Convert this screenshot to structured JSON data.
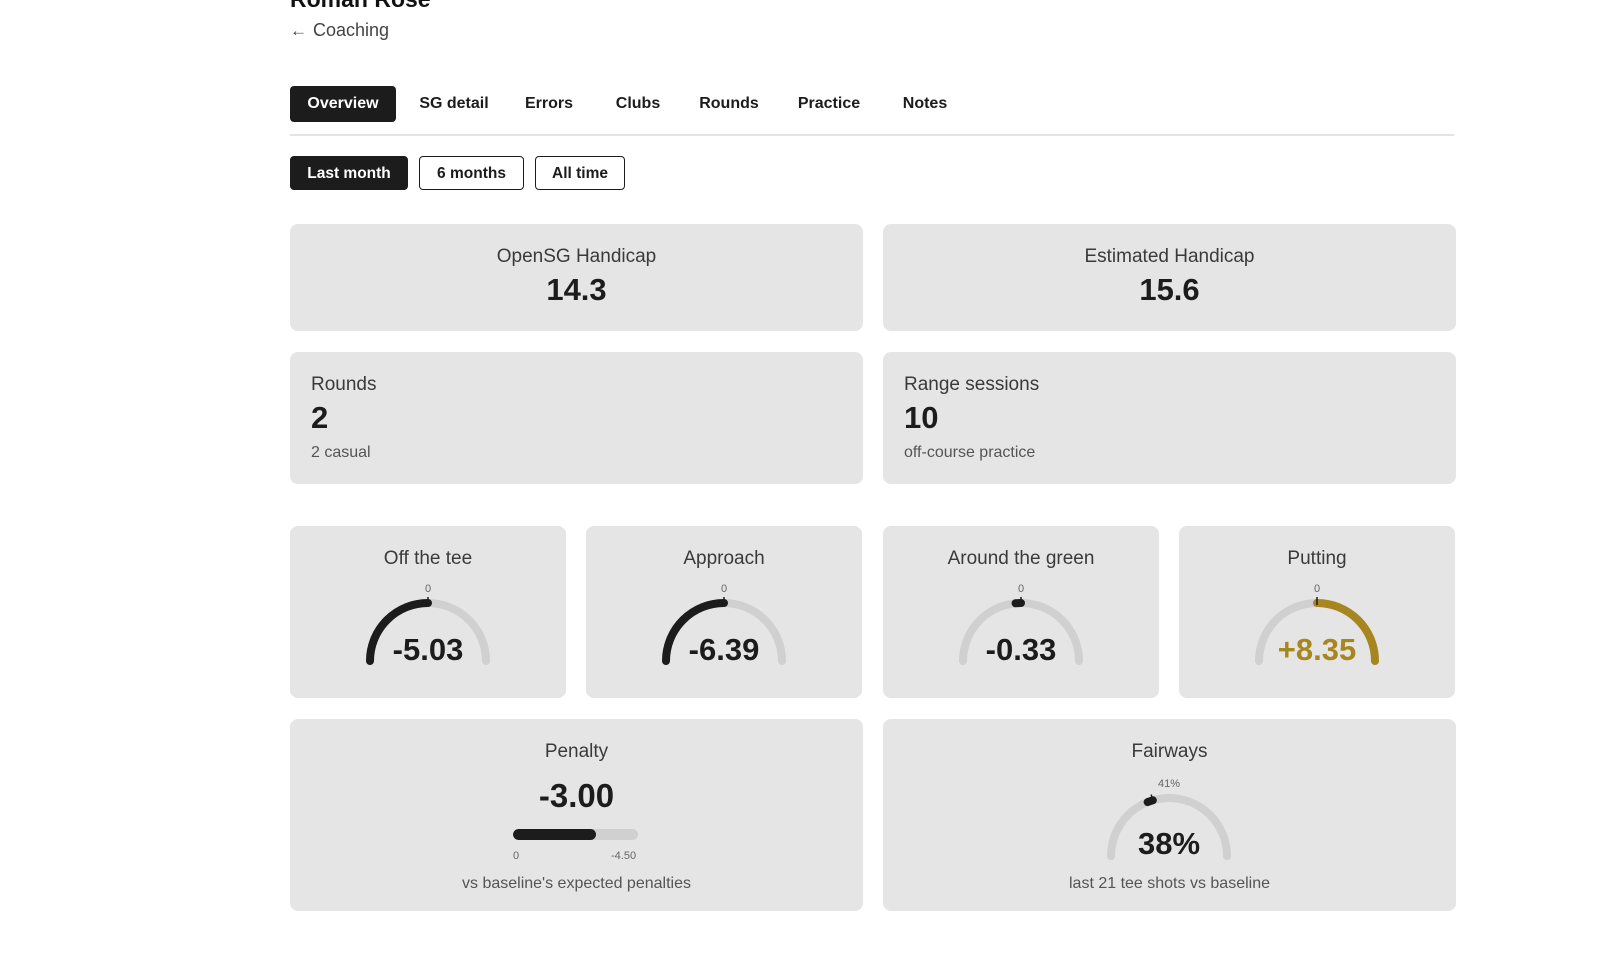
{
  "header": {
    "title": "Roman Rose",
    "back_label": "Coaching",
    "back_icon": "arrow-left-icon"
  },
  "tabs": [
    {
      "label": "Overview",
      "active": true
    },
    {
      "label": "SG detail",
      "active": false
    },
    {
      "label": "Errors",
      "active": false
    },
    {
      "label": "Clubs",
      "active": false
    },
    {
      "label": "Rounds",
      "active": false
    },
    {
      "label": "Practice",
      "active": false
    },
    {
      "label": "Notes",
      "active": false
    }
  ],
  "filters": [
    {
      "label": "Last month",
      "active": true
    },
    {
      "label": "6 months",
      "active": false
    },
    {
      "label": "All time",
      "active": false
    }
  ],
  "handicaps": {
    "opensg": {
      "label": "OpenSG Handicap",
      "value": "14.3"
    },
    "estimated": {
      "label": "Estimated Handicap",
      "value": "15.6"
    }
  },
  "stats": {
    "rounds": {
      "label": "Rounds",
      "value": "2",
      "sub": "2 casual"
    },
    "range": {
      "label": "Range sessions",
      "value": "10",
      "sub": "off-course practice"
    }
  },
  "sg": [
    {
      "label": "Off the tee",
      "value": "-5.03",
      "zero_label": "0",
      "fill_fraction": 0.5
    },
    {
      "label": "Approach",
      "value": "-6.39",
      "zero_label": "0",
      "fill_fraction": 0.5
    },
    {
      "label": "Around the green",
      "value": "-0.33",
      "zero_label": "0",
      "fill_fraction": 0.03
    },
    {
      "label": "Putting",
      "value": "+8.35",
      "zero_label": "0",
      "fill_fraction": 0.5
    }
  ],
  "penalty": {
    "label": "Penalty",
    "value": "-3.00",
    "bar_min_label": "0",
    "bar_max_label": "-4.50",
    "bar_fraction": 0.667,
    "caption": "vs baseline's expected penalties"
  },
  "fairways": {
    "label": "Fairways",
    "value": "38%",
    "baseline_label": "41%",
    "value_fraction": 0.38,
    "baseline_fraction": 0.41,
    "caption": "last 21 tee shots vs baseline"
  },
  "colors": {
    "dark": "#1c1c1c",
    "card": "#e5e5e5",
    "track": "#d0d0d0",
    "positive": "#a8861f"
  }
}
